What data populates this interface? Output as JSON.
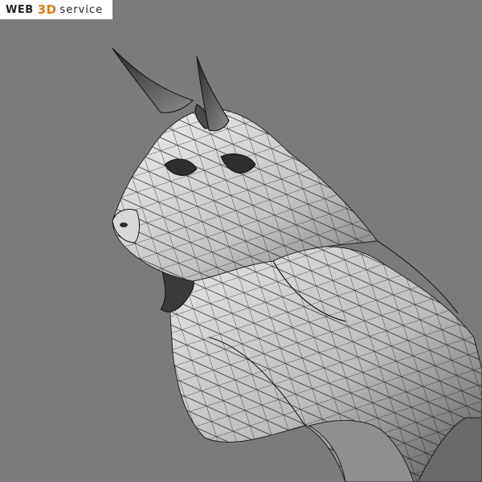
{
  "watermark": {
    "word1": "WEB",
    "word2": "3D",
    "word3": "service",
    "accent_color": "#e07a10"
  },
  "scene": {
    "background_color": "#7b7b7b",
    "subject": "bull-wireframe-model"
  }
}
